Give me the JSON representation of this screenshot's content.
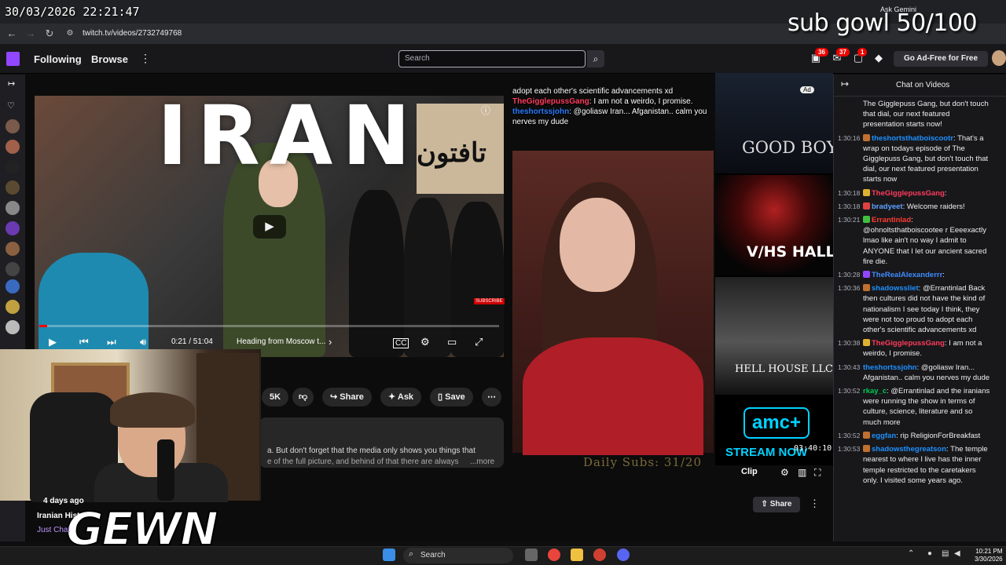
{
  "overlay": {
    "datetime": "30/03/2026 22:21:47",
    "sub_goal": "sub gowl 50/100",
    "daily_subs": "Daily Subs: 31/20",
    "cam_timer": "03:40:10",
    "logo": "GEWN"
  },
  "browser": {
    "url": "twitch.tv/videos/2732749768",
    "ask_gemini": "Ask Gemini"
  },
  "twitch_nav": {
    "following": "Following",
    "browse": "Browse",
    "search_placeholder": "Search",
    "badges": [
      "36",
      "37",
      "1"
    ],
    "go_adfree": "Go Ad-Free for Free"
  },
  "youtube": {
    "big_title": "IRAN",
    "time": "0:21 / 51:04",
    "chapter": "Heading from Moscow t...",
    "likes": "5K",
    "share": "Share",
    "ask": "Ask",
    "save": "Save",
    "desc_line1": "a. But don't forget that the media only shows you things that",
    "desc_line2": "e of the full picture, and behind of that there are always",
    "more": "...more",
    "subscribe": "SUBSCRIBE"
  },
  "overlay_chat": [
    {
      "text": "adopt each other's scientific advancements xd"
    },
    {
      "user": "TheGigglepussGang",
      "text": ": I am not a weirdo, I promise."
    },
    {
      "user": "theshortssjohn",
      "text": ": @goliasw Iran... Afganistan.. calm you nerves my dude"
    }
  ],
  "ads": {
    "goodboy": "GOOD BOY",
    "vhs": "V/HS HALLOWEEN",
    "hellhouse": "HELL HOUSE LLC LINEAGE",
    "amc": "amc+",
    "streamnow": "STREAM NOW",
    "ad_label": "Ad"
  },
  "player": {
    "clip": "Clip"
  },
  "below": {
    "posted": "4 days ago",
    "title": "Iranian Histo",
    "category": "Just Chat",
    "share": "Share"
  },
  "chat": {
    "title": "Chat on Videos",
    "messages": [
      {
        "ts": "",
        "user": "",
        "color": "#efeff1",
        "text": "The Gigglepuss Gang, but don't touch that dial, our next featured presentation starts now!"
      },
      {
        "ts": "1:30:16",
        "user": "theshortsthatboiscootr",
        "color": "#1e90ff",
        "text": ": That's a wrap on todays episode of The Gigglepuss Gang, but don't touch that dial, our next featured presentation starts now"
      },
      {
        "ts": "1:30:18",
        "user": "TheGigglepussGang",
        "color": "#ff3b5c",
        "text": ":"
      },
      {
        "ts": "1:30:18",
        "user": "bradyeet",
        "color": "#5ea2ff",
        "text": ": Welcome raiders!"
      },
      {
        "ts": "1:30:21",
        "user": "Errantinlad",
        "color": "#ff3b30",
        "text": ": @ohnoltsthatboiscootee r Eeeexactly lmao like ain't no way I admit to ANYONE that I let our ancient sacred fire die."
      },
      {
        "ts": "1:30:28",
        "user": "TheRealAlexanderrr",
        "color": "#3f8cff",
        "text": ":"
      },
      {
        "ts": "1:30:36",
        "user": "shadowssliet",
        "color": "#1e90ff",
        "text": ": @Errantinlad Back then cultures did not have the kind of nationalism I see today I think, they were not too proud to adopt each other's scientific advancements xd"
      },
      {
        "ts": "1:30:38",
        "user": "TheGigglepussGang",
        "color": "#ff3b5c",
        "text": ": I am not a weirdo, I promise."
      },
      {
        "ts": "1:30:43",
        "user": "theshortssjohn",
        "color": "#1e90ff",
        "text": ": @goliasw Iran... Afganistan.. calm you nerves my dude"
      },
      {
        "ts": "1:30:52",
        "user": "rkay_c",
        "color": "#00c853",
        "text": ": @Errantinlad and the iranians were running the show in terms of culture, science, literature and so much more"
      },
      {
        "ts": "1:30:52",
        "user": "eggfan",
        "color": "#1e90ff",
        "text": ": rip ReligionForBreakfast"
      },
      {
        "ts": "1:30:53",
        "user": "shadowsthegreatson",
        "color": "#1e90ff",
        "text": ": The temple nearest to where I live has the inner temple restricted to the caretakers only. I visited some years ago."
      }
    ]
  },
  "taskbar": {
    "search": "Search",
    "time": "10:21 PM",
    "date": "3/30/2026"
  },
  "colors": {
    "twitch_purple": "#9147ff",
    "bg": "#0e0e10",
    "amc": "#00d2ff"
  }
}
